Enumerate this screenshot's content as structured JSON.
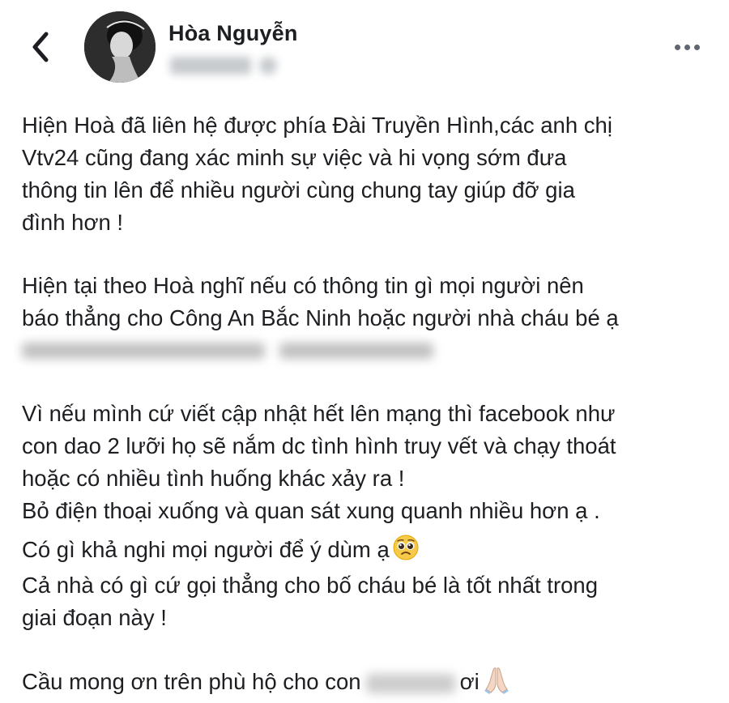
{
  "header": {
    "author_name": "Hòa Nguyễn",
    "back_icon": "chevron-left-icon",
    "more_icon": "more-horizontal-icon"
  },
  "post": {
    "p1": [
      "Hiện Hoà đã liên hệ được phía Đài Truyền Hình,các anh chị",
      "Vtv24 cũng đang xác minh sự việc và hi vọng sớm đưa",
      "thông tin lên để nhiều người cùng chung tay giúp đỡ gia",
      "đình hơn !"
    ],
    "p2": [
      "Hiện tại theo Hoà nghĩ nếu có thông tin gì mọi người nên",
      "báo thẳng cho Công An Bắc Ninh hoặc người nhà cháu bé ạ"
    ],
    "p3": [
      "Vì nếu mình cứ viết cập nhật hết lên mạng thì facebook như",
      "con dao 2 lưỡi họ sẽ nắm dc tình hình truy vết và chạy thoát",
      "hoặc có nhiều tình huống khác xảy ra !",
      "Bỏ điện thoại xuống và quan sát xung quanh nhiều hơn ạ ."
    ],
    "p4_line1": "Có gì khả nghi mọi người để ý dùm ạ",
    "p4_rest": [
      "Cả nhà có gì cứ gọi thẳng cho bố cháu bé là tốt nhất trong",
      "giai đoạn này !"
    ],
    "last_prefix": "Cầu mong ơn trên phù hộ cho con",
    "last_suffix": "ơi"
  },
  "colors": {
    "text": "#1c1e21",
    "secondary": "#606770"
  }
}
